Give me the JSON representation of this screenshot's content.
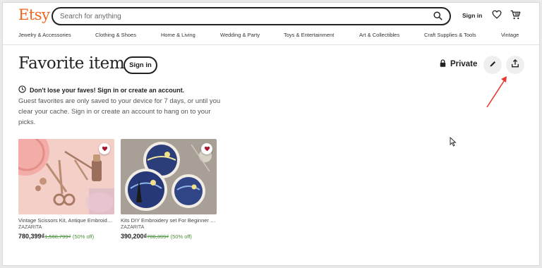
{
  "header": {
    "logo": "Etsy",
    "search_placeholder": "Search for anything",
    "sign_in": "Sign in"
  },
  "categories": [
    "Jewelry & Accessories",
    "Clothing & Shoes",
    "Home & Living",
    "Wedding & Party",
    "Toys & Entertainment",
    "Art & Collectibles",
    "Craft Supplies & Tools",
    "Vintage"
  ],
  "page": {
    "title": "Favorite items",
    "sign_in_button": "Sign in",
    "privacy": "Private",
    "notice_title": "Don't lose your faves! Sign in or create an account.",
    "notice_body": "Guest favorites are only saved to your device for 7 days, or until you clear your cache. Sign in or create an account to hang on to your picks."
  },
  "items": [
    {
      "name": "Vintage Scissors Kit, Antique Embroidery Scissors",
      "shop": "ZAZARITA",
      "price": "780,399₫",
      "original_price": "1,560,799₫",
      "discount": "(50% off)"
    },
    {
      "name": "Kits DIY Embroidery set For Beginner flower",
      "shop": "ZAZARITA",
      "price": "390,200₫",
      "original_price": "780,399₫",
      "discount": "(50% off)"
    }
  ],
  "colors": {
    "brand": "#f1641e",
    "favorite_heart": "#a61a2e",
    "discount": "#4a8f3c",
    "annotation_arrow": "#e53935"
  },
  "icons": [
    "search-icon",
    "heart-icon",
    "cart-icon",
    "lock-icon",
    "pencil-icon",
    "share-icon",
    "clock-icon",
    "favorite-heart-icon"
  ]
}
